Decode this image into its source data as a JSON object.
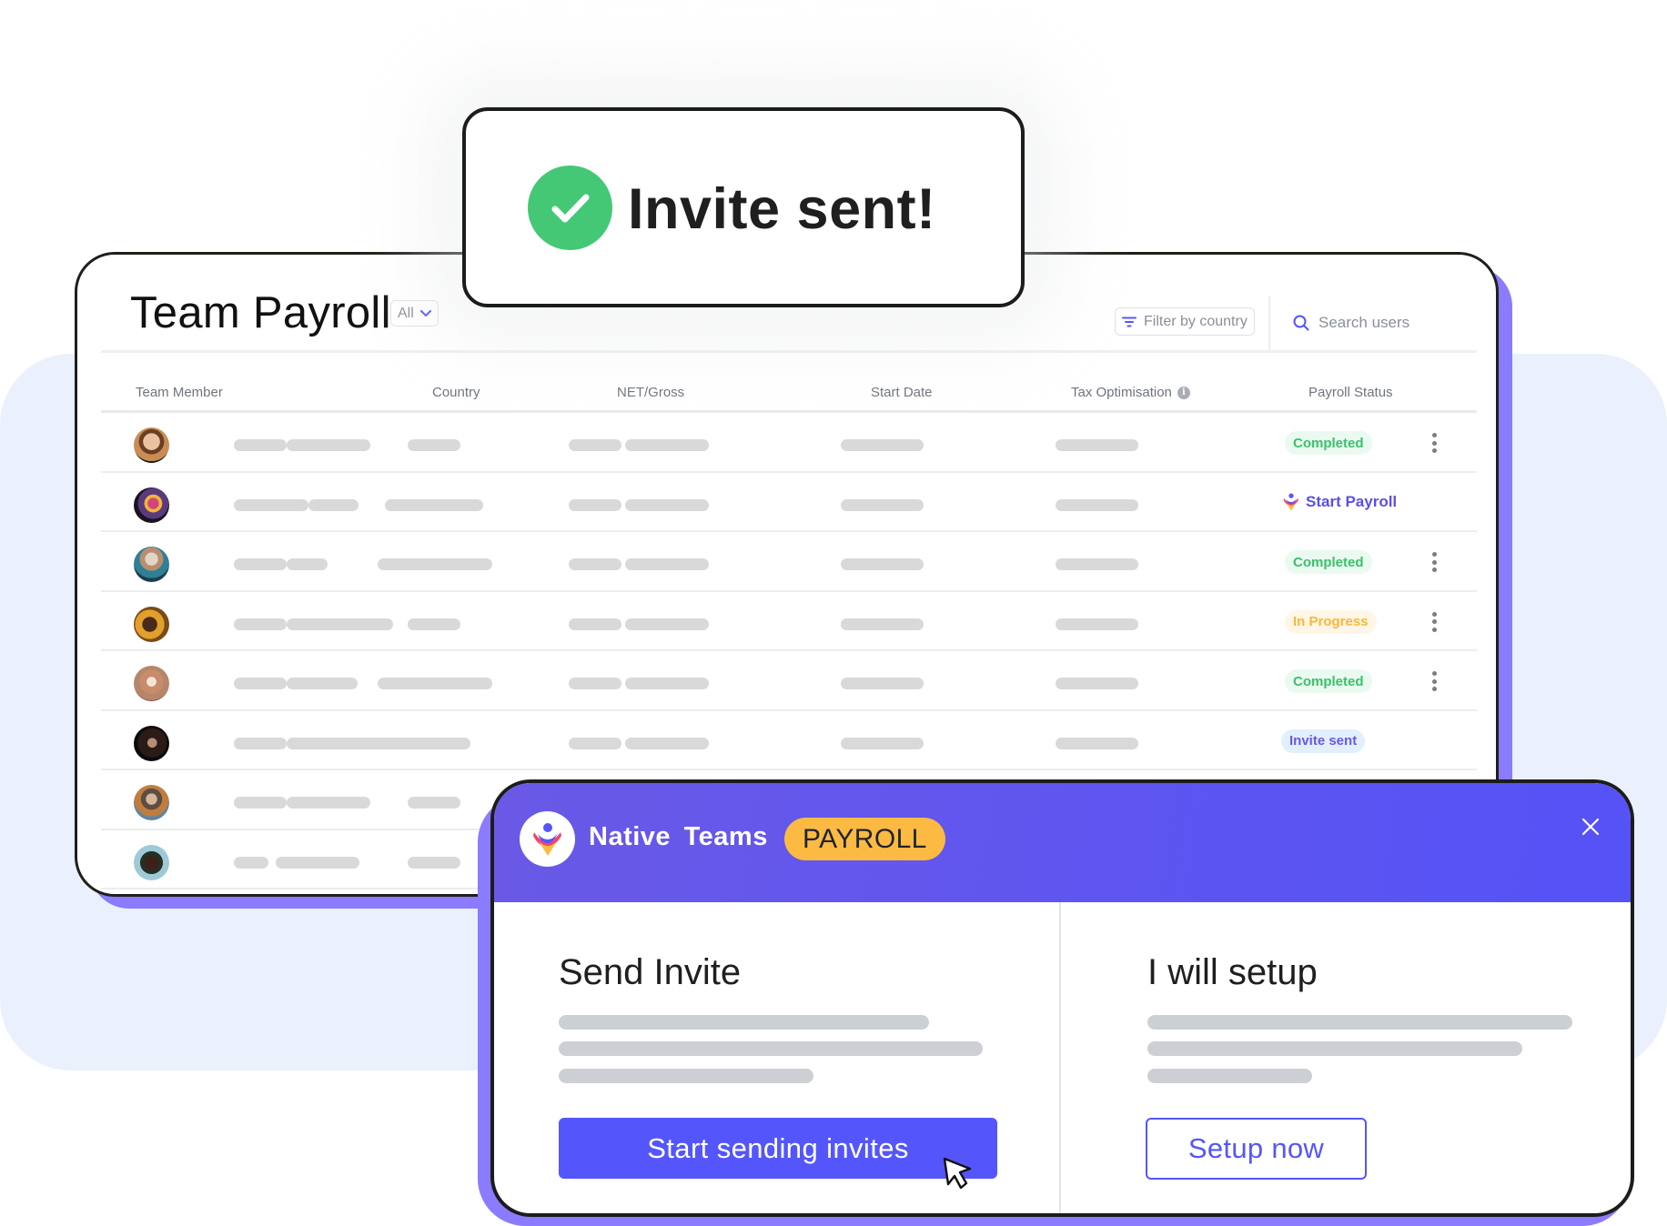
{
  "toast": {
    "icon": "check-circle-icon",
    "message": "Invite sent!",
    "accent": "#45c876"
  },
  "payroll": {
    "title": "Team Payroll",
    "scope_select": {
      "value": "All",
      "icon": "chevron-down-icon"
    },
    "filter_button": {
      "label": "Filter by country",
      "icon": "filter-icon"
    },
    "search": {
      "placeholder": "Search users",
      "icon": "search-icon"
    },
    "columns": [
      "Team Member",
      "Country",
      "NET/Gross",
      "Start Date",
      "Tax Optimisation",
      "Payroll Status"
    ],
    "tax_info_icon": "info-icon",
    "rows": [
      {
        "status": "Completed",
        "status_type": "completed",
        "has_menu": true
      },
      {
        "status": "Start Payroll",
        "status_type": "action",
        "has_menu": false
      },
      {
        "status": "Completed",
        "status_type": "completed",
        "has_menu": true
      },
      {
        "status": "In Progress",
        "status_type": "progress",
        "has_menu": true
      },
      {
        "status": "Completed",
        "status_type": "completed",
        "has_menu": true
      },
      {
        "status": "Invite sent",
        "status_type": "invite",
        "has_menu": false
      },
      {
        "status": "",
        "status_type": "hidden",
        "has_menu": false
      },
      {
        "status": "",
        "status_type": "hidden",
        "has_menu": false
      }
    ],
    "status_colors": {
      "completed": "#3cc06a",
      "progress": "#fbb636",
      "invite": "#6a5ae0",
      "action": "#5a4fe8"
    }
  },
  "modal": {
    "brand": "Native Teams",
    "product_pill": "PAYROLL",
    "close_icon": "close-icon",
    "options": [
      {
        "title": "Send Invite",
        "button": "Start sending invites"
      },
      {
        "title": "I will setup",
        "button": "Setup now"
      }
    ],
    "primary_color": "#5456fc",
    "pill_color": "#fdba42"
  }
}
